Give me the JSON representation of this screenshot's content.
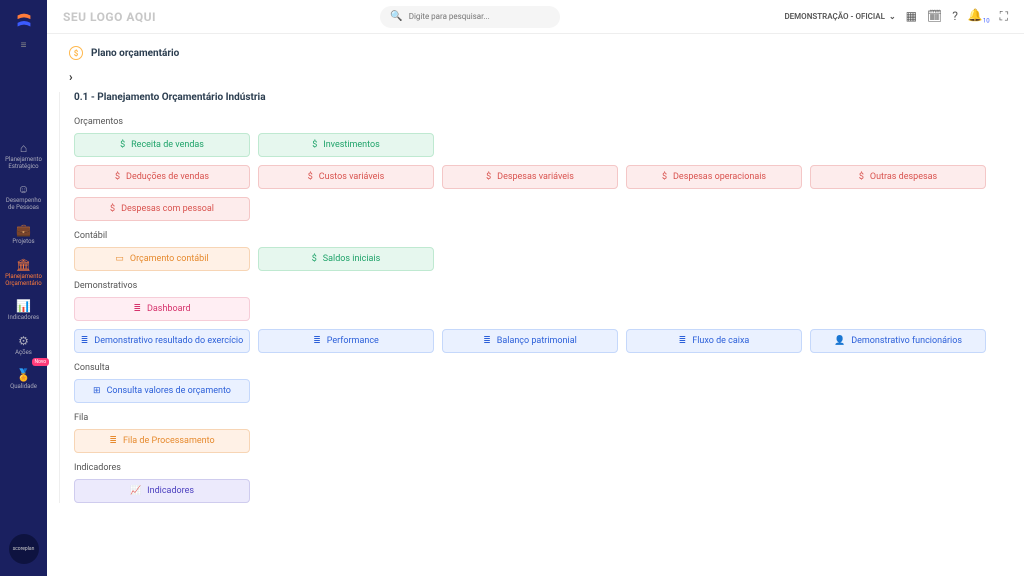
{
  "header": {
    "logo_text": "SEU LOGO AQUI",
    "search_placeholder": "Digite para pesquisar...",
    "context_label": "DEMONSTRAÇÃO - OFICIAL",
    "badge_count": "10"
  },
  "sidebar": {
    "items": [
      {
        "label": "Planejamento Estratégico"
      },
      {
        "label": "Desempenho de Pessoas"
      },
      {
        "label": "Projetos"
      },
      {
        "label": "Planejamento Orçamentário"
      },
      {
        "label": "Indicadores"
      },
      {
        "label": "Ações"
      },
      {
        "label": "Qualidade"
      }
    ],
    "badge": "Novo",
    "footer": "scoreplan"
  },
  "page": {
    "title": "Plano orçamentário",
    "section_title": "0.1 - Planejamento Orçamentário Indústria"
  },
  "groups": {
    "orcamentos": {
      "label": "Orçamentos",
      "items": [
        {
          "label": "Receita de vendas",
          "color": "green",
          "icon": "$"
        },
        {
          "label": "Investimentos",
          "color": "green",
          "icon": "$"
        },
        {
          "label": "Deduções de vendas",
          "color": "red",
          "icon": "$"
        },
        {
          "label": "Custos variáveis",
          "color": "red",
          "icon": "$"
        },
        {
          "label": "Despesas variáveis",
          "color": "red",
          "icon": "$"
        },
        {
          "label": "Despesas operacionais",
          "color": "red",
          "icon": "$"
        },
        {
          "label": "Outras despesas",
          "color": "red",
          "icon": "$"
        },
        {
          "label": "Despesas com pessoal",
          "color": "red",
          "icon": "$"
        }
      ]
    },
    "contabil": {
      "label": "Contábil",
      "items": [
        {
          "label": "Orçamento contábil",
          "color": "orange",
          "icon": "▭"
        },
        {
          "label": "Saldos iniciais",
          "color": "green",
          "icon": "$"
        }
      ]
    },
    "demonstrativos": {
      "label": "Demonstrativos",
      "row1": [
        {
          "label": "Dashboard",
          "color": "pink",
          "icon": "≣"
        }
      ],
      "row2": [
        {
          "label": "Demonstrativo resultado do exercício",
          "color": "blue",
          "icon": "≣"
        },
        {
          "label": "Performance",
          "color": "blue",
          "icon": "≣"
        },
        {
          "label": "Balanço patrimonial",
          "color": "blue",
          "icon": "≣"
        },
        {
          "label": "Fluxo de caixa",
          "color": "blue",
          "icon": "≣"
        },
        {
          "label": "Demonstrativo funcionários",
          "color": "blue",
          "icon": "👤"
        }
      ]
    },
    "consulta": {
      "label": "Consulta",
      "items": [
        {
          "label": "Consulta valores de orçamento",
          "color": "blue",
          "icon": "⊞"
        }
      ]
    },
    "fila": {
      "label": "Fila",
      "items": [
        {
          "label": "Fila de Processamento",
          "color": "orange",
          "icon": "≣"
        }
      ]
    },
    "indicadores": {
      "label": "Indicadores",
      "items": [
        {
          "label": "Indicadores",
          "color": "indigo",
          "icon": "📈"
        }
      ]
    }
  }
}
